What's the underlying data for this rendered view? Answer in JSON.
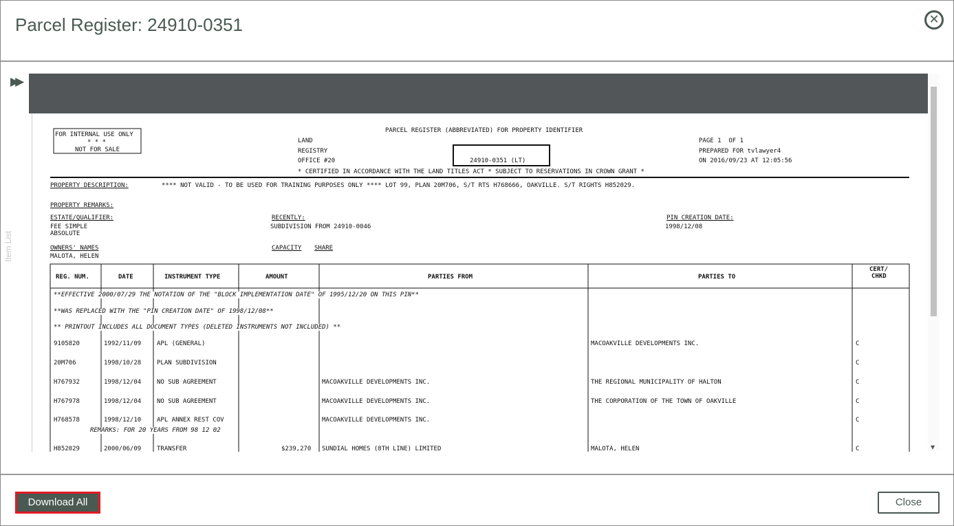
{
  "modal": {
    "title": "Parcel Register: 24910-0351",
    "close_icon": "close-circle-icon"
  },
  "side_panel": {
    "label": "Item List",
    "expand_icon": "double-chevron-right-icon"
  },
  "document": {
    "internal_box": {
      "line1": "FOR INTERNAL USE ONLY",
      "line2": "* * *",
      "line3": "NOT FOR SALE"
    },
    "office": {
      "line1": "LAND",
      "line2": "REGISTRY",
      "line3": "OFFICE #20"
    },
    "header_title": "PARCEL REGISTER (ABBREVIATED) FOR PROPERTY IDENTIFIER",
    "pin": "24910-0351 (LT)",
    "certified": "* CERTIFIED IN ACCORDANCE WITH THE LAND TITLES ACT * SUBJECT TO RESERVATIONS IN CROWN GRANT *",
    "page": "PAGE 1  OF 1",
    "prepared_for": "PREPARED FOR tvlawyer4",
    "prepared_on": "ON 2016/09/23 AT 12:05:56",
    "property_description_label": "PROPERTY DESCRIPTION:",
    "property_description": "**** NOT VALID - TO BE USED FOR TRAINING PURPOSES ONLY **** LOT 99, PLAN 20M706, S/T RTS H768666, OAKVILLE. S/T RIGHTS H852029.",
    "property_remarks_label": "PROPERTY REMARKS:",
    "estate_label": "ESTATE/QUALIFIER:",
    "estate_line1": "FEE SIMPLE",
    "estate_line2": "ABSOLUTE",
    "recently_label": "RECENTLY:",
    "recently_value": "SUBDIVISION FROM 24910-0046",
    "pin_creation_label": "PIN CREATION DATE:",
    "pin_creation_value": "1998/12/08",
    "owners_label": "OWNERS' NAMES",
    "capacity_label": "CAPACITY",
    "share_label": "SHARE",
    "owner_name": "MALOTA, HELEN",
    "columns": {
      "reg_num": "REG. NUM.",
      "date": "DATE",
      "instrument_type": "INSTRUMENT TYPE",
      "amount": "AMOUNT",
      "parties_from": "PARTIES FROM",
      "parties_to": "PARTIES TO",
      "cert_line1": "CERT/",
      "cert_line2": "CHKD"
    },
    "notes": [
      "**EFFECTIVE 2000/07/29 THE NOTATION OF THE \"BLOCK IMPLEMENTATION DATE\" OF 1995/12/20 ON THIS PIN**",
      "**WAS REPLACED WITH THE \"PIN CREATION DATE\" OF 1998/12/08**",
      "** PRINTOUT INCLUDES ALL DOCUMENT TYPES (DELETED INSTRUMENTS NOT INCLUDED) **"
    ],
    "rows": [
      {
        "reg": "9105820",
        "date": "1992/11/09",
        "type": "APL (GENERAL)",
        "amount": "",
        "from": "",
        "to": "MACOAKVILLE DEVELOPMENTS INC.",
        "cert": "C"
      },
      {
        "reg": "20M706",
        "date": "1998/10/28",
        "type": "PLAN SUBDIVISION",
        "amount": "",
        "from": "",
        "to": "",
        "cert": "C"
      },
      {
        "reg": "H767932",
        "date": "1998/12/04",
        "type": "NO SUB AGREEMENT",
        "amount": "",
        "from": "MACOAKVILLE DEVELOPMENTS INC.",
        "to": "THE REGIONAL MUNICIPALITY OF HALTON",
        "cert": "C"
      },
      {
        "reg": "H767978",
        "date": "1998/12/04",
        "type": "NO SUB AGREEMENT",
        "amount": "",
        "from": "MACOAKVILLE DEVELOPMENTS INC.",
        "to": "THE CORPORATION OF THE TOWN OF OAKVILLE",
        "cert": "C"
      },
      {
        "reg": "H768578",
        "date": "1998/12/10",
        "type": "APL ANNEX REST COV",
        "amount": "",
        "from": "MACOAKVILLE DEVELOPMENTS INC.",
        "to": "",
        "cert": "C"
      },
      {
        "reg": "H852029",
        "date": "2000/06/09",
        "type": "TRANSFER",
        "amount": "$239,270",
        "from": "SUNDIAL HOMES (8TH LINE) LIMITED",
        "to": "MALOTA, HELEN",
        "cert": "C"
      }
    ],
    "remarks": "REMARKS: FOR 20 YEARS FROM 98 12 02"
  },
  "footer": {
    "download_label": "Download All",
    "close_label": "Close"
  },
  "colors": {
    "accent": "#4a5a52",
    "highlight": "#e01b24",
    "viewer_bar": "#525659"
  }
}
